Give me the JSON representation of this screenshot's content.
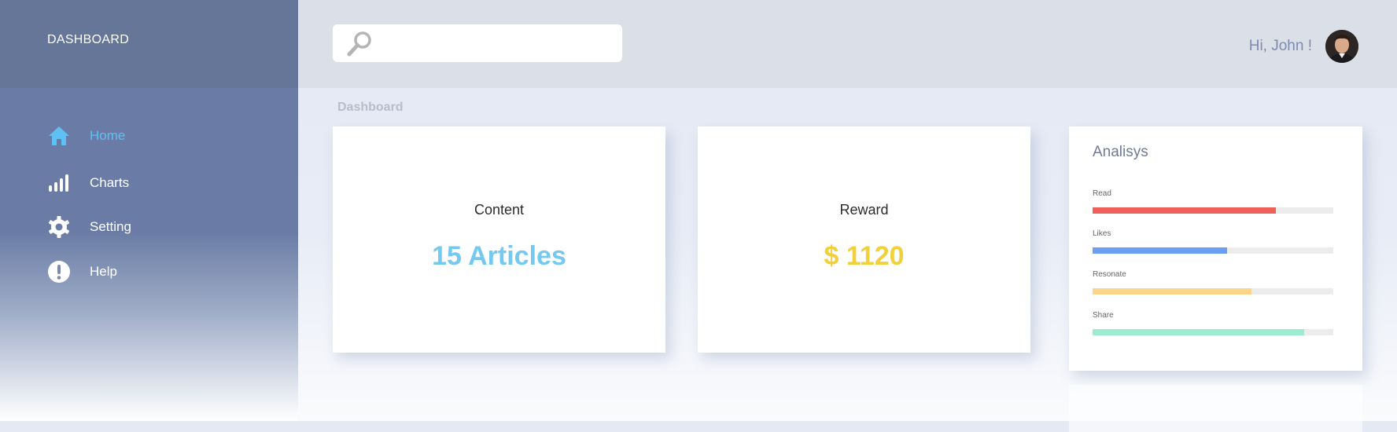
{
  "sidebar": {
    "brand": "DASHBOARD",
    "items": [
      {
        "label": "Home",
        "icon": "home-icon",
        "active": true
      },
      {
        "label": "Charts",
        "icon": "bar-chart-icon",
        "active": false
      },
      {
        "label": "Setting",
        "icon": "gear-icon",
        "active": false
      },
      {
        "label": "Help",
        "icon": "exclamation-icon",
        "active": false
      }
    ]
  },
  "header": {
    "search": {
      "placeholder": "",
      "value": "",
      "icon": "search-icon"
    },
    "greeting": "Hi, John !",
    "avatar": "user-avatar"
  },
  "main": {
    "title": "Dashboard",
    "cards": [
      {
        "title": "Content",
        "value": "15 Articles",
        "color": "#74c9f1"
      },
      {
        "title": "Reward",
        "value": "$ 1120",
        "color": "#f2d03b"
      }
    ],
    "analysis": {
      "title": "Analisys",
      "bars": [
        {
          "label": "Read",
          "value": 0.76,
          "color": "#f0605a"
        },
        {
          "label": "Likes",
          "value": 0.56,
          "color": "#6a9ef2"
        },
        {
          "label": "Resonate",
          "value": 0.66,
          "color": "#fbd589"
        },
        {
          "label": "Share",
          "value": 0.88,
          "color": "#9aebd0"
        }
      ]
    }
  },
  "colors": {
    "accent": "#5ec0f3",
    "sidebar": "#6a7ca5",
    "header": "#dbdfe8"
  }
}
